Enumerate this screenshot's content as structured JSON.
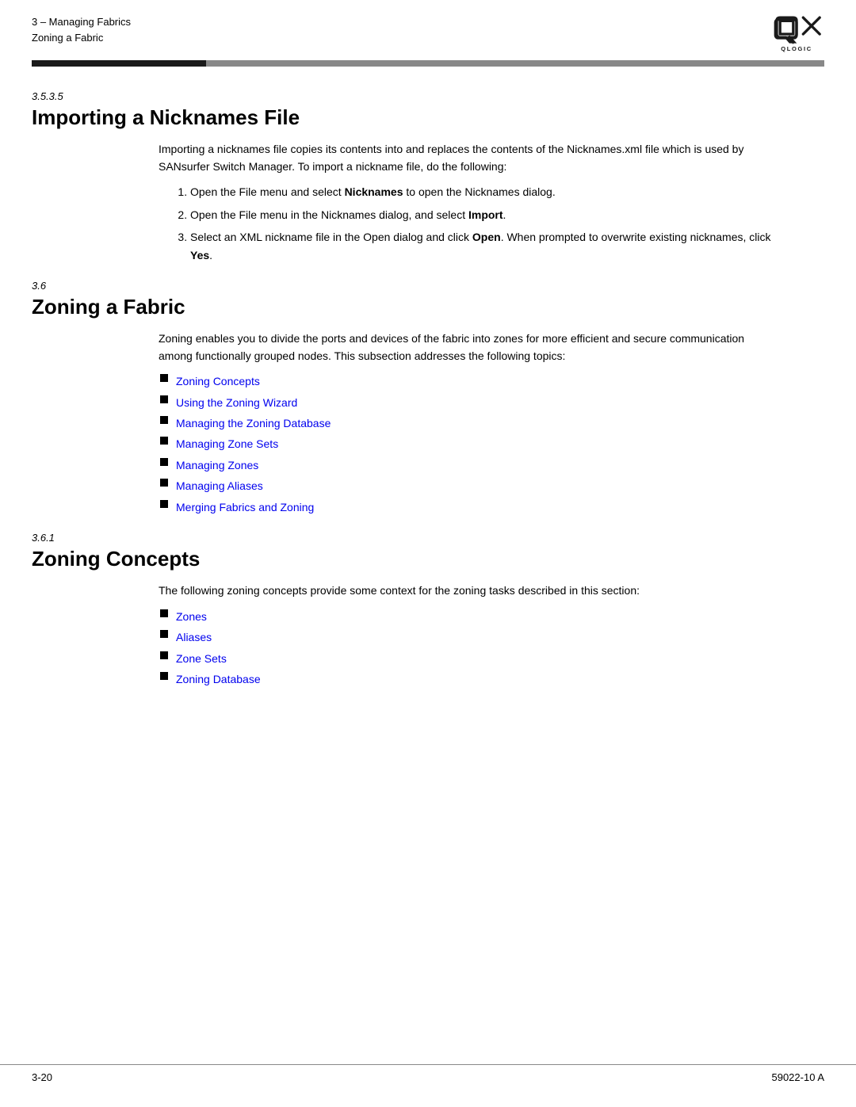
{
  "header": {
    "breadcrumb_line1": "3 – Managing Fabrics",
    "breadcrumb_line2": "Zoning a Fabric",
    "logo_alt": "QLogic Logo"
  },
  "section1": {
    "number": "3.5.3.5",
    "heading": "Importing a Nicknames File",
    "intro": "Importing a nicknames file copies its contents into and replaces the contents of the Nicknames.xml file which is used by SANsurfer Switch Manager. To import a nickname file, do the following:",
    "steps": [
      {
        "text_before": "Open the File menu and select ",
        "bold": "Nicknames",
        "text_after": " to open the Nicknames dialog."
      },
      {
        "text_before": "Open the File menu in the Nicknames dialog, and select ",
        "bold": "Import",
        "text_after": "."
      },
      {
        "text_before": "Select an XML nickname file in the Open dialog and click ",
        "bold": "Open",
        "text_after": ". When prompted to overwrite existing nicknames, click ",
        "bold2": "Yes",
        "text_after2": "."
      }
    ]
  },
  "section2": {
    "number": "3.6",
    "heading": "Zoning a Fabric",
    "intro": "Zoning enables you to divide the ports and devices of the fabric into zones for more efficient and secure communication among functionally grouped nodes. This subsection addresses the following topics:",
    "links": [
      "Zoning Concepts",
      "Using the Zoning Wizard",
      "Managing the Zoning Database",
      "Managing Zone Sets",
      "Managing Zones",
      "Managing Aliases",
      "Merging Fabrics and Zoning"
    ]
  },
  "section3": {
    "number": "3.6.1",
    "heading": "Zoning Concepts",
    "intro": "The following zoning concepts provide some context for the zoning tasks described in this section:",
    "links": [
      "Zones",
      "Aliases",
      "Zone Sets",
      "Zoning Database"
    ]
  },
  "footer": {
    "left": "3-20",
    "right": "59022-10  A"
  }
}
